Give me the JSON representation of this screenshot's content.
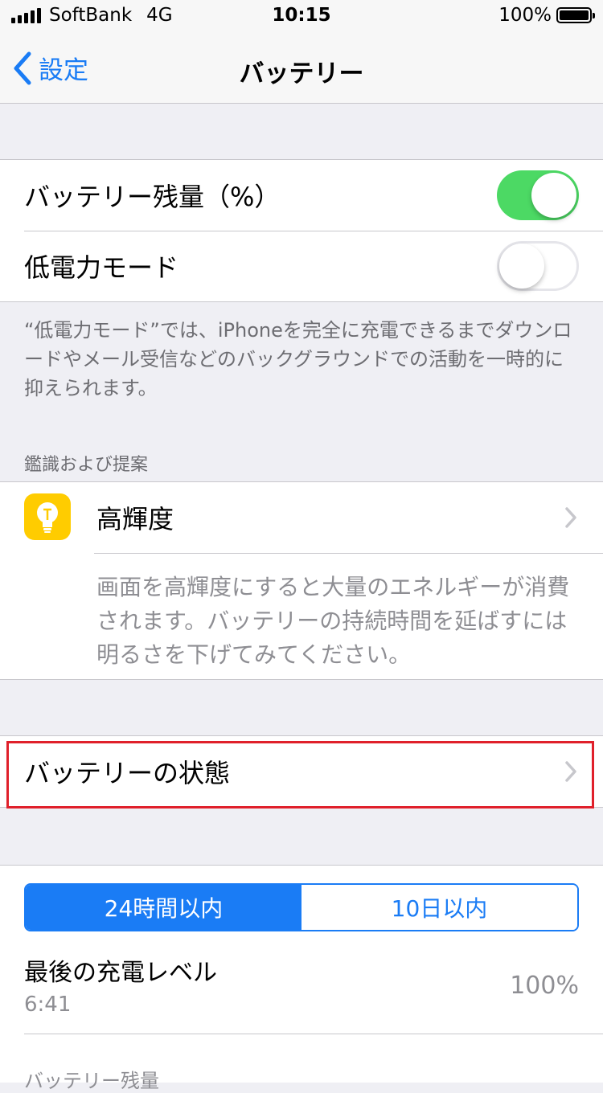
{
  "status_bar": {
    "carrier": "SoftBank",
    "network": "4G",
    "time": "10:15",
    "battery": "100%"
  },
  "nav": {
    "back_label": "設定",
    "title": "バッテリー"
  },
  "battery_group": {
    "percent_label": "バッテリー残量（%）",
    "percent_on": true,
    "low_power_label": "低電力モード",
    "low_power_on": false
  },
  "low_power_footer": "“低電力モード”では、iPhoneを完全に充電できるまでダウンロードやメール受信などのバックグラウンドでの活動を一時的に抑えられます。",
  "suggestions": {
    "header": "鑑識および提案",
    "item_label": "高輝度",
    "item_icon": "lightbulb-icon",
    "item_description": "画面を高輝度にすると大量のエネルギーが消費されます。バッテリーの持続時間を延ばすには明るさを下げてみてください。"
  },
  "battery_health": {
    "label": "バッテリーの状態"
  },
  "usage": {
    "segments": [
      "24時間以内",
      "10日以内"
    ],
    "selected_segment": "24時間以内",
    "last_charge_label": "最後の充電レベル",
    "last_charge_time": "6:41",
    "last_charge_value": "100%",
    "next_header": "バッテリー残量"
  },
  "colors": {
    "accent": "#1a7cf5",
    "toggle_on": "#4cd964",
    "highlight": "#e0202b",
    "icon_bg": "#ffcc00"
  }
}
